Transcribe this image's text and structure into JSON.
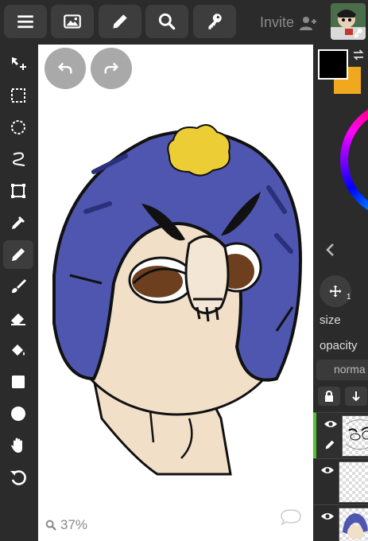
{
  "header": {
    "invite_label": "Invite",
    "icons": [
      "menu-icon",
      "image-icon",
      "pencil-icon",
      "search-icon",
      "key-icon",
      "user-plus-icon"
    ]
  },
  "tools": [
    "transform",
    "rect-select",
    "lasso-select",
    "free-select",
    "crop",
    "eyedropper",
    "brush",
    "soft-brush",
    "eraser",
    "fill",
    "shape-rect",
    "shape-circle",
    "hand",
    "rotate"
  ],
  "active_tool": "brush",
  "canvas": {
    "zoom_label": "37%"
  },
  "colors": {
    "primary": "#000000",
    "secondary": "#f0a91e",
    "accent": "#52c234"
  },
  "panel": {
    "size_label": "size",
    "opacity_label": "opacity",
    "blend_mode": "norma",
    "move_badge": "1"
  }
}
